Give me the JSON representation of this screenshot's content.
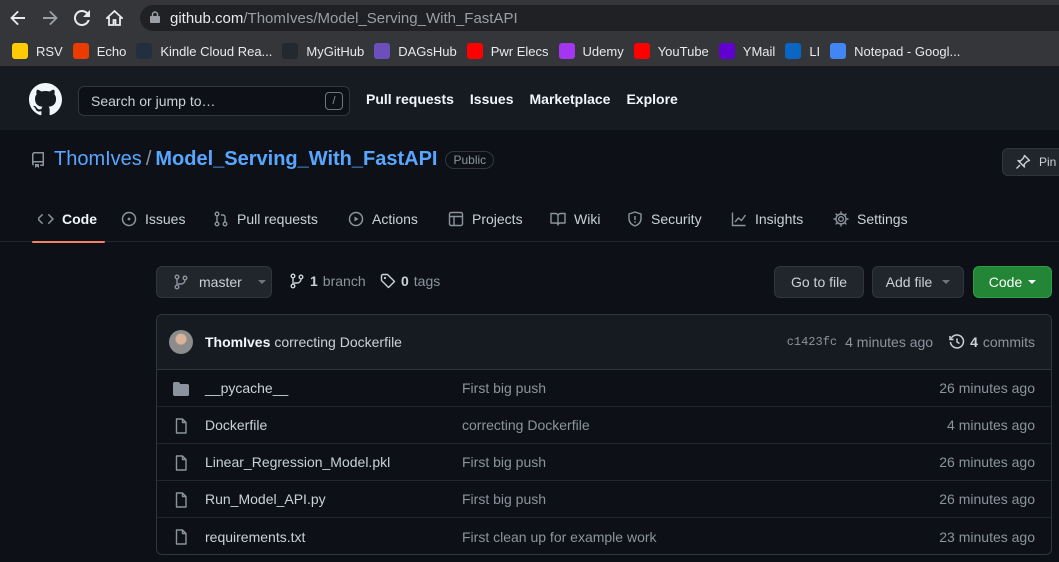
{
  "browser": {
    "url_host": "github.com",
    "url_path": "/ThomIves/Model_Serving_With_FastAPI",
    "bookmarks": [
      {
        "label": "RSV",
        "icon": "michigan-icon",
        "color": "#ffcb05"
      },
      {
        "label": "Echo",
        "icon": "office-icon",
        "color": "#eb3c00"
      },
      {
        "label": "Kindle Cloud Rea...",
        "icon": "kindle-icon",
        "color": "#232f3e"
      },
      {
        "label": "MyGitHub",
        "icon": "github-icon",
        "color": "#24292f"
      },
      {
        "label": "DAGsHub",
        "icon": "dagshub-icon",
        "color": "#6b4fbb"
      },
      {
        "label": "Pwr Elecs",
        "icon": "youtube-icon",
        "color": "#ff0000"
      },
      {
        "label": "Udemy",
        "icon": "udemy-icon",
        "color": "#a435f0"
      },
      {
        "label": "YouTube",
        "icon": "youtube-icon",
        "color": "#ff0000"
      },
      {
        "label": "YMail",
        "icon": "yahoo-icon",
        "color": "#6001d2"
      },
      {
        "label": "LI",
        "icon": "linkedin-icon",
        "color": "#0a66c2"
      },
      {
        "label": "Notepad - Googl...",
        "icon": "docs-icon",
        "color": "#4285f4"
      }
    ]
  },
  "header": {
    "search_placeholder": "Search or jump to…",
    "search_shortcut": "/",
    "nav": [
      "Pull requests",
      "Issues",
      "Marketplace",
      "Explore"
    ]
  },
  "repo": {
    "owner": "ThomIves",
    "separator": "/",
    "name": "Model_Serving_With_FastAPI",
    "visibility": "Public",
    "pin_label": "Pin"
  },
  "tabs": [
    "Code",
    "Issues",
    "Pull requests",
    "Actions",
    "Projects",
    "Wiki",
    "Security",
    "Insights",
    "Settings"
  ],
  "file_nav": {
    "branch": "master",
    "branch_count": "1",
    "branch_label": "branch",
    "tag_count": "0",
    "tag_label": "tags",
    "go_to_file": "Go to file",
    "add_file": "Add file",
    "code": "Code"
  },
  "latest_commit": {
    "author": "ThomIves",
    "message": "correcting Dockerfile",
    "sha": "c1423fc",
    "age": "4 minutes ago",
    "commit_count": "4",
    "commit_label": "commits"
  },
  "files": [
    {
      "name": "__pycache__",
      "type": "folder",
      "message": "First big push",
      "age": "26 minutes ago"
    },
    {
      "name": "Dockerfile",
      "type": "file",
      "message": "correcting Dockerfile",
      "age": "4 minutes ago"
    },
    {
      "name": "Linear_Regression_Model.pkl",
      "type": "file",
      "message": "First big push",
      "age": "26 minutes ago"
    },
    {
      "name": "Run_Model_API.py",
      "type": "file",
      "message": "First big push",
      "age": "26 minutes ago"
    },
    {
      "name": "requirements.txt",
      "type": "file",
      "message": "First clean up for example work",
      "age": "23 minutes ago"
    }
  ]
}
